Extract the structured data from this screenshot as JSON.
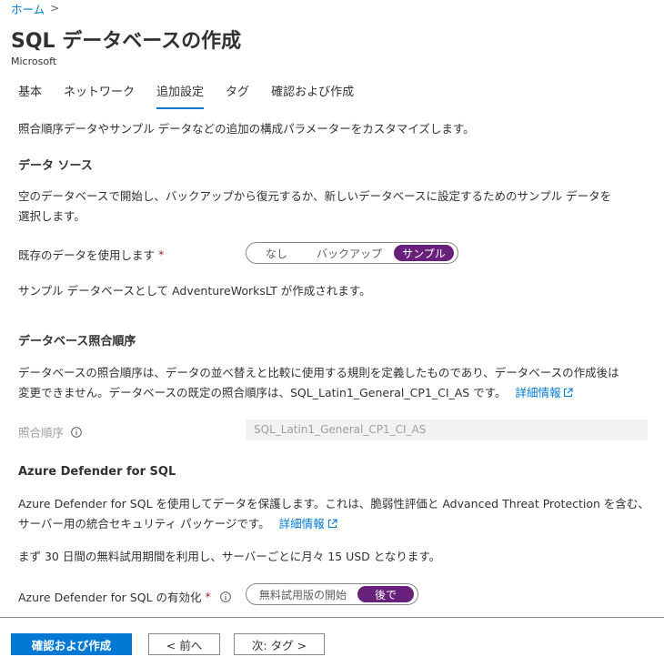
{
  "breadcrumb": {
    "home": "ホーム",
    "separator": ">"
  },
  "header": {
    "title": "SQL データベースの作成",
    "publisher": "Microsoft"
  },
  "tabs": [
    {
      "label": "基本",
      "active": false
    },
    {
      "label": "ネットワーク",
      "active": false
    },
    {
      "label": "追加設定",
      "active": true
    },
    {
      "label": "タグ",
      "active": false
    },
    {
      "label": "確認および作成",
      "active": false
    }
  ],
  "intro": "照合順序データやサンプル データなどの追加の構成パラメーターをカスタマイズします。",
  "data_source": {
    "heading": "データ ソース",
    "desc_line1": "空のデータベースで開始し、バックアップから復元するか、新しいデータベースに設定するためのサンプル データを",
    "desc_line2": "選択します。",
    "field_label": "既存のデータを使用します",
    "required_mark": "*",
    "options": [
      "なし",
      "バックアップ",
      "サンプル"
    ],
    "selected": "サンプル",
    "note": "サンプル データベースとして AdventureWorksLT が作成されます。"
  },
  "collation": {
    "heading": "データベース照合順序",
    "desc_line1": "データベースの照合順序は、データの並べ替えと比較に使用する規則を定義したものであり、データベースの作成後は",
    "desc_line2": "変更できません。データベースの既定の照合順序は、SQL_Latin1_General_CP1_CI_AS です。",
    "learn_more": "詳細情報",
    "field_label": "照合順序",
    "value": "SQL_Latin1_General_CP1_CI_AS"
  },
  "defender": {
    "heading": "Azure Defender for SQL",
    "desc_line1": "Azure Defender for SQL を使用してデータを保護します。これは、脆弱性評価と Advanced Threat Protection を含む、",
    "desc_line2": "サーバー用の統合セキュリティ パッケージです。",
    "learn_more": "詳細情報",
    "trial_note": "まず 30 日間の無料試用期間を利用し、サーバーごとに月々 15 USD となります。",
    "field_label": "Azure Defender for SQL の有効化",
    "required_mark": "*",
    "options": [
      "無料試用版の開始",
      "後で"
    ],
    "selected": "後で"
  },
  "footer": {
    "review_create": "確認および作成",
    "previous": "< 前へ",
    "next": "次: タグ >"
  },
  "colors": {
    "accent": "#0078d4",
    "toggle_selected": "#68217a",
    "required": "#a4262c"
  }
}
